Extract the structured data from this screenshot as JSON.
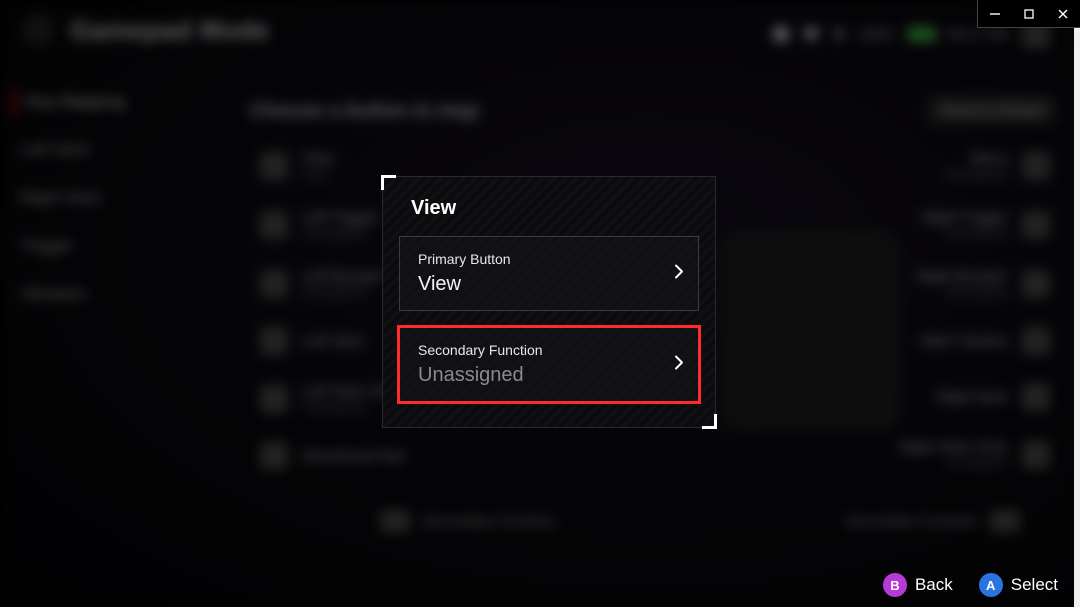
{
  "header": {
    "title": "Gamepad Mode",
    "battery_pct": "100%",
    "time": "06:17 PM"
  },
  "sidebar": {
    "items": [
      {
        "label": "Key Mapping",
        "active": true
      },
      {
        "label": "Left Stick"
      },
      {
        "label": "Right Stick"
      },
      {
        "label": "Trigger"
      },
      {
        "label": "Vibration"
      }
    ]
  },
  "main": {
    "subtitle": "Choose a button to map",
    "reset_label": "Reset to Default",
    "left_items": [
      {
        "label": "View",
        "value": "View"
      },
      {
        "label": "Left Trigger",
        "value": "Unassigned"
      },
      {
        "label": "Left Bumper",
        "value": "Unassigned"
      },
      {
        "label": "Left Stick",
        "value": ""
      },
      {
        "label": "Left Stick Click",
        "value": "Unassigned"
      },
      {
        "label": "Directional Pad",
        "value": ""
      }
    ],
    "right_items": [
      {
        "label": "Menu",
        "value": "Unassigned"
      },
      {
        "label": "Right Trigger",
        "value": "Unassigned"
      },
      {
        "label": "Right Bumper",
        "value": "Unassigned"
      },
      {
        "label": "ABXY Button",
        "value": ""
      },
      {
        "label": "Right Stick",
        "value": ""
      },
      {
        "label": "Right Stick Click",
        "value": "Unassigned"
      }
    ],
    "secondary_label": "Secondary Function"
  },
  "modal": {
    "title": "View",
    "primary": {
      "caption": "Primary Button",
      "value": "View"
    },
    "secondary": {
      "caption": "Secondary Function",
      "value": "Unassigned"
    }
  },
  "hints": {
    "back": "Back",
    "select": "Select"
  }
}
